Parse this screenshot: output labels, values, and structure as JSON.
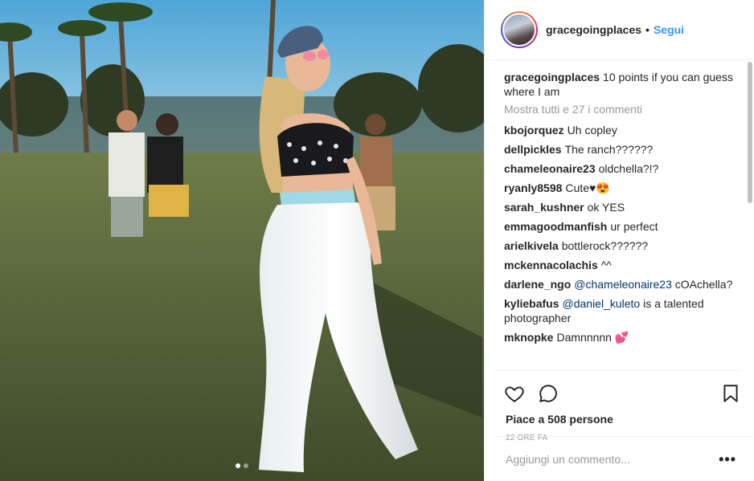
{
  "post": {
    "carousel_count": 2,
    "carousel_active": 1
  },
  "header": {
    "username": "gracegoingplaces",
    "separator": "•",
    "follow_label": "Segui"
  },
  "caption": {
    "username": "gracegoingplaces",
    "text": "10 points if you can guess where I am"
  },
  "view_all_label": "Mostra tutti e 27 i commenti",
  "comments": [
    {
      "user": "kbojorquez",
      "text": "Uh copley"
    },
    {
      "user": "dellpickles",
      "text": "The ranch??????"
    },
    {
      "user": "chameleonaire23",
      "text": "oldchella?!?"
    },
    {
      "user": "ryanly8598",
      "text": "Cute♥😍"
    },
    {
      "user": "sarah_kushner",
      "text": "ok YES"
    },
    {
      "user": "emmagoodmanfish",
      "text": "ur perfect"
    },
    {
      "user": "arielkivela",
      "text": "bottlerock??????"
    },
    {
      "user": "mckennacolachis",
      "text": "^^"
    },
    {
      "user": "darlene_ngo",
      "mention": "@chameleonaire23",
      "text": "cOAchella?"
    },
    {
      "user": "kyliebafus",
      "mention": "@daniel_kuleto",
      "text": "is a talented photographer"
    },
    {
      "user": "mknopke",
      "text": "Damnnnnn 💕"
    }
  ],
  "actions": {
    "like_icon": "heart-icon",
    "comment_icon": "comment-icon",
    "save_icon": "bookmark-icon"
  },
  "likes_text": "Piace a 508 persone",
  "time_text": "22 ORE FA",
  "add_comment": {
    "placeholder": "Aggiungi un commento...",
    "more_label": "•••"
  },
  "colors": {
    "link_blue": "#3897f0",
    "mention_blue": "#003569",
    "muted": "#999999",
    "text": "#262626"
  }
}
